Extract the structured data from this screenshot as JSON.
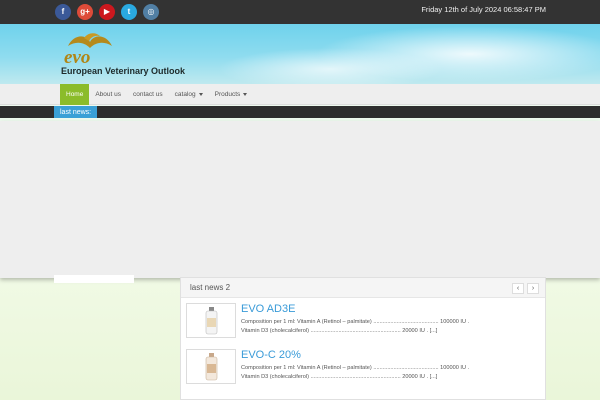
{
  "topbar": {
    "social": [
      {
        "icon": "facebook-icon",
        "glyph": "f",
        "color": "#3b5998"
      },
      {
        "icon": "google-plus-icon",
        "glyph": "g+",
        "color": "#dd4b39"
      },
      {
        "icon": "youtube-icon",
        "glyph": "▶",
        "color": "#cc181e"
      },
      {
        "icon": "twitter-icon",
        "glyph": "t",
        "color": "#2aa9e0"
      },
      {
        "icon": "instagram-icon",
        "glyph": "◎",
        "color": "#517fa4"
      }
    ],
    "datetime": "Friday 12th of July 2024 06:58:47 PM"
  },
  "header": {
    "logo_text": "evo",
    "site_name": "European Veterinary Outlook"
  },
  "nav": {
    "items": [
      {
        "label": "Home",
        "active": true
      },
      {
        "label": "About us"
      },
      {
        "label": "contact us"
      },
      {
        "label": "catalog",
        "dropdown": true
      },
      {
        "label": "Products",
        "dropdown": true
      }
    ]
  },
  "ticker": {
    "label": "last news:"
  },
  "news": {
    "title": "last news 2",
    "prev": "‹",
    "next": "›",
    "items": [
      {
        "title": "EVO AD3E",
        "line1": "Composition per 1 ml: Vitamin A (Retinol – palmitate) ..........................................  100000 IU .",
        "line2": "Vitamin D3 (cholecalciferol) ..........................................................  20000 IU . [...]"
      },
      {
        "title": "EVO-C 20%",
        "line1": "Composition per 1 ml: Vitamin A (Retinol – palmitate) ..........................................  100000 IU .",
        "line2": "Vitamin D3 (cholecalciferol) ..........................................................  20000 IU . [...]"
      }
    ]
  },
  "colors": {
    "accent": "#8bbc2a",
    "link": "#3a9bd8",
    "ticker": "#3aa0d6"
  }
}
